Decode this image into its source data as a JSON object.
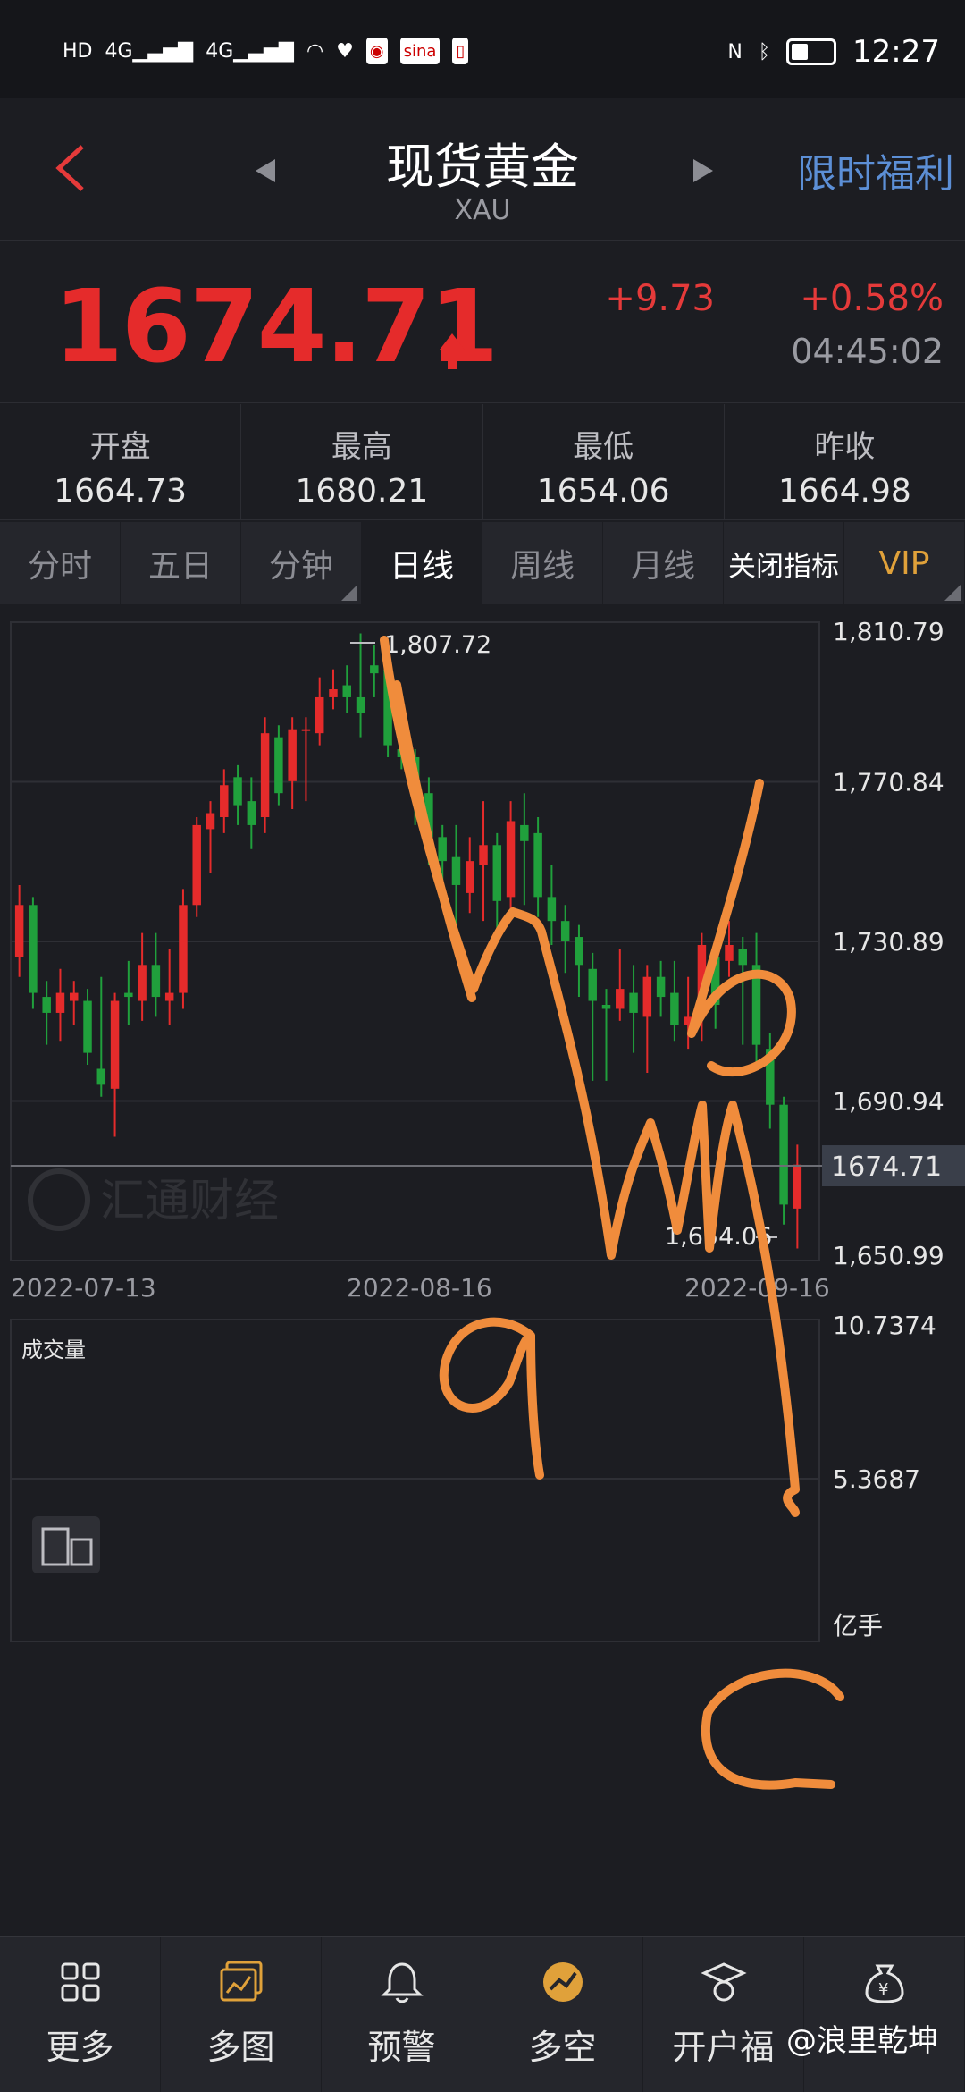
{
  "status_bar": {
    "time": "12:27",
    "indicators": [
      "HD",
      "4G",
      "4G",
      "wifi",
      "heart",
      "weibo",
      "sina",
      "book"
    ]
  },
  "header": {
    "title": "现货黄金",
    "symbol": "XAU",
    "promo": "限时福利"
  },
  "quote": {
    "price": "1674.71",
    "change": "+9.73",
    "change_pct": "+0.58%",
    "time": "04:45:02",
    "up_color": "#e52b2b",
    "down_color": "#20a03c"
  },
  "stats": [
    {
      "label": "开盘",
      "value": "1664.73"
    },
    {
      "label": "最高",
      "value": "1680.21"
    },
    {
      "label": "最低",
      "value": "1654.06"
    },
    {
      "label": "昨收",
      "value": "1664.98"
    }
  ],
  "tabs": [
    {
      "label": "分时"
    },
    {
      "label": "五日"
    },
    {
      "label": "分钟"
    },
    {
      "label": "日线"
    },
    {
      "label": "周线"
    },
    {
      "label": "月线"
    },
    {
      "label": "关闭指标"
    },
    {
      "label": "VIP"
    }
  ],
  "chart_data": {
    "type": "candlestick",
    "y_ticks": [
      "1,810.79",
      "1,770.84",
      "1,730.89",
      "1,690.94",
      "1,650.99"
    ],
    "ylim": [
      1650.99,
      1810.79
    ],
    "x_ticks": [
      "2022-07-13",
      "2022-08-16",
      "2022-09-16"
    ],
    "current_price_label": "1674.71",
    "current_price": 1674.71,
    "high_label": "1,807.72",
    "low_label": "1,654.06",
    "watermark": "汇通财经",
    "volume_label": "成交量",
    "volume_ticks": [
      "10.7374",
      "5.3687"
    ],
    "volume_unit": "亿手",
    "candles": [
      [
        1727,
        1740,
        1722,
        1745
      ],
      [
        1740,
        1718,
        1714,
        1742
      ],
      [
        1717,
        1713,
        1705,
        1721
      ],
      [
        1713,
        1718,
        1706,
        1724
      ],
      [
        1716,
        1718,
        1710,
        1721
      ],
      [
        1716,
        1703,
        1700,
        1719
      ],
      [
        1699,
        1695,
        1692,
        1722
      ],
      [
        1694,
        1716,
        1682,
        1718
      ],
      [
        1718,
        1717,
        1710,
        1726
      ],
      [
        1716,
        1725,
        1711,
        1733
      ],
      [
        1725,
        1717,
        1712,
        1733
      ],
      [
        1716,
        1718,
        1710,
        1729
      ],
      [
        1718,
        1740,
        1714,
        1744
      ],
      [
        1740,
        1760,
        1737,
        1762
      ],
      [
        1759,
        1763,
        1748,
        1766
      ],
      [
        1762,
        1770,
        1758,
        1774
      ],
      [
        1772,
        1765,
        1760,
        1775
      ],
      [
        1766,
        1760,
        1754,
        1772
      ],
      [
        1762,
        1783,
        1758,
        1787
      ],
      [
        1782,
        1768,
        1765,
        1785
      ],
      [
        1771,
        1784,
        1764,
        1787
      ],
      [
        1784,
        1784,
        1766,
        1787
      ],
      [
        1783,
        1792,
        1780,
        1797
      ],
      [
        1792,
        1794,
        1789,
        1799
      ],
      [
        1795,
        1792,
        1788,
        1800
      ],
      [
        1792,
        1788,
        1782,
        1808
      ],
      [
        1800,
        1798,
        1792,
        1805
      ],
      [
        1799,
        1780,
        1777,
        1801
      ],
      [
        1779,
        1777,
        1774,
        1786
      ],
      [
        1777,
        1769,
        1760,
        1779
      ],
      [
        1768,
        1757,
        1750,
        1772
      ],
      [
        1757,
        1751,
        1740,
        1760
      ],
      [
        1752,
        1745,
        1727,
        1760
      ],
      [
        1743,
        1751,
        1738,
        1757
      ],
      [
        1750,
        1755,
        1736,
        1766
      ],
      [
        1755,
        1741,
        1734,
        1758
      ],
      [
        1742,
        1761,
        1738,
        1766
      ],
      [
        1760,
        1756,
        1740,
        1768
      ],
      [
        1758,
        1742,
        1737,
        1762
      ],
      [
        1742,
        1736,
        1730,
        1750
      ],
      [
        1736,
        1731,
        1723,
        1740
      ],
      [
        1732,
        1725,
        1717,
        1735
      ],
      [
        1724,
        1716,
        1696,
        1728
      ],
      [
        1715,
        1714,
        1696,
        1719
      ],
      [
        1714,
        1719,
        1711,
        1729
      ],
      [
        1718,
        1713,
        1703,
        1725
      ],
      [
        1712,
        1722,
        1698,
        1725
      ],
      [
        1722,
        1717,
        1712,
        1726
      ],
      [
        1718,
        1710,
        1706,
        1726
      ],
      [
        1710,
        1712,
        1704,
        1722
      ],
      [
        1712,
        1730,
        1706,
        1733
      ],
      [
        1727,
        1715,
        1709,
        1730
      ],
      [
        1726,
        1730,
        1722,
        1736
      ],
      [
        1729,
        1725,
        1705,
        1732
      ],
      [
        1725,
        1705,
        1700,
        1733
      ],
      [
        1704,
        1690,
        1684,
        1708
      ],
      [
        1690,
        1665,
        1660,
        1692
      ],
      [
        1664,
        1675,
        1654,
        1680
      ]
    ]
  },
  "annotations": {
    "wave_a": "a",
    "wave_b": "b",
    "wave_c": "c",
    "stroke_color": "#f08c3c"
  },
  "bottom_nav": [
    {
      "label": "更多",
      "icon": "grid-icon"
    },
    {
      "label": "多图",
      "icon": "multi-chart-icon"
    },
    {
      "label": "预警",
      "icon": "bell-icon"
    },
    {
      "label": "多空",
      "icon": "bull-bear-icon"
    },
    {
      "label": "开户福",
      "icon": "graduation-icon"
    },
    {
      "label": "",
      "icon": "money-bag-icon"
    }
  ],
  "overlay_credit": "@浪里乾坤"
}
